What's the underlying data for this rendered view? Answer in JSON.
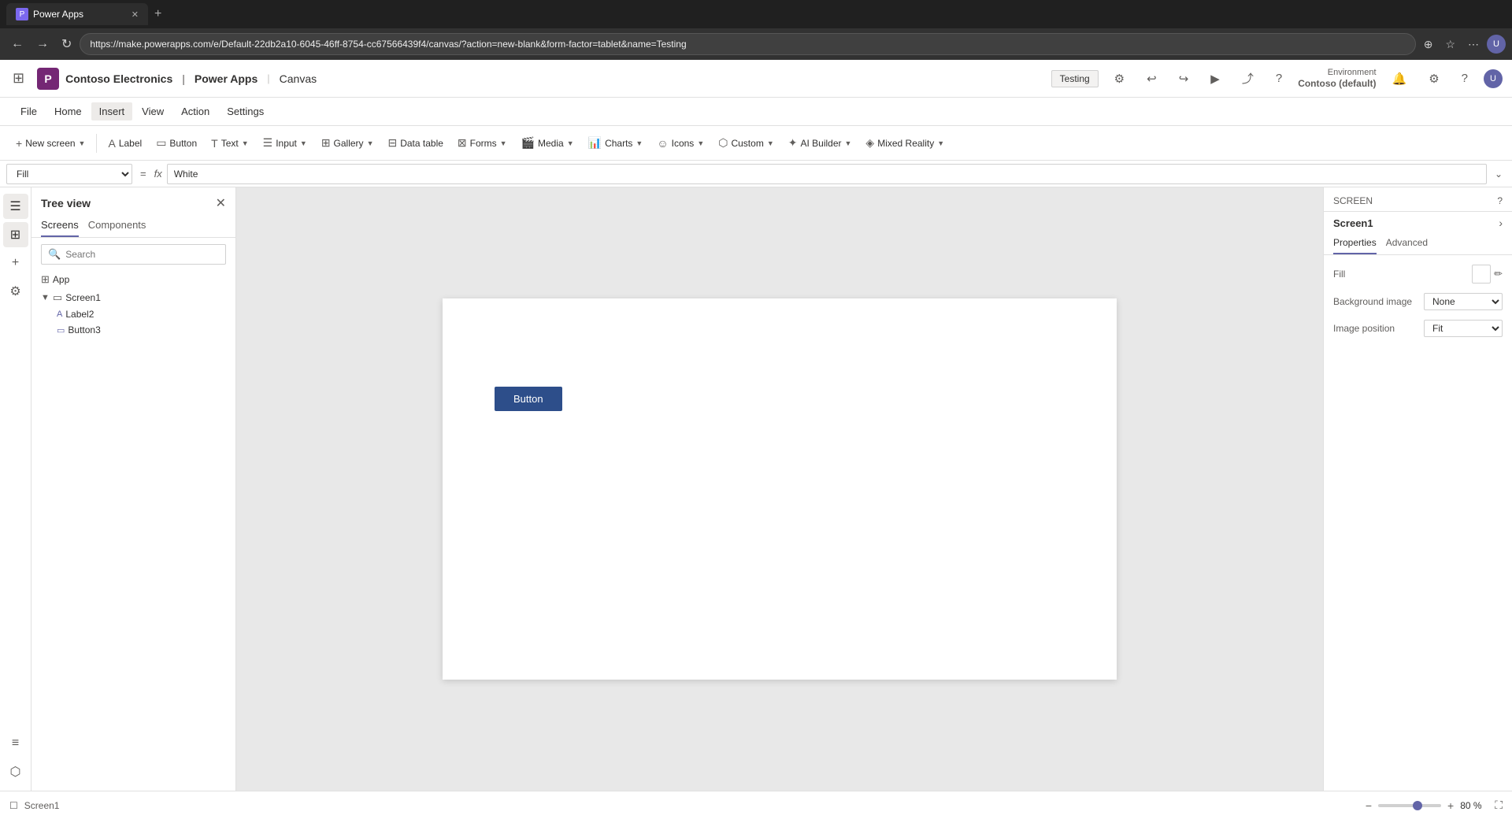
{
  "browser": {
    "tab_label": "Power Apps",
    "tab_icon": "P",
    "address": "https://make.powerapps.com/e/Default-22db2a10-6045-46ff-8754-cc67566439f4/canvas/?action=new-blank&form-factor=tablet&name=Testing",
    "add_tab_title": "New tab"
  },
  "header": {
    "waffle_icon": "⊞",
    "brand_name": "Contoso Electronics",
    "app_suite": "Power Apps",
    "divider": "|",
    "canvas": "Canvas",
    "env_label": "Environment",
    "env_name": "Contoso (default)",
    "testing_label": "Testing"
  },
  "menubar": {
    "items": [
      "File",
      "Home",
      "Insert",
      "View",
      "Action",
      "Settings"
    ],
    "active": "Insert"
  },
  "toolbar": {
    "new_screen_label": "New screen",
    "label_label": "Label",
    "button_label": "Button",
    "text_label": "Text",
    "input_label": "Input",
    "gallery_label": "Gallery",
    "data_table_label": "Data table",
    "forms_label": "Forms",
    "media_label": "Media",
    "charts_label": "Charts",
    "icons_label": "Icons",
    "custom_label": "Custom",
    "ai_builder_label": "AI Builder",
    "mixed_reality_label": "Mixed Reality"
  },
  "formula_bar": {
    "selector_value": "Fill",
    "equals_sign": "=",
    "fx_label": "fx",
    "formula_value": "White"
  },
  "treeview": {
    "title": "Tree view",
    "tabs": [
      "Screens",
      "Components"
    ],
    "active_tab": "Screens",
    "search_placeholder": "Search",
    "items": [
      {
        "type": "app",
        "label": "App",
        "icon": "⊞",
        "indent": 0
      },
      {
        "type": "screen",
        "label": "Screen1",
        "icon": "▭",
        "indent": 0,
        "expanded": true
      },
      {
        "type": "label",
        "label": "Label2",
        "icon": "A",
        "indent": 1
      },
      {
        "type": "button",
        "label": "Button3",
        "icon": "◻",
        "indent": 1
      }
    ]
  },
  "canvas": {
    "button_label": "Button"
  },
  "right_panel": {
    "section_label": "SCREEN",
    "help_icon": "?",
    "screen_name": "Screen1",
    "expand_icon": "›",
    "tabs": [
      "Properties",
      "Advanced"
    ],
    "active_tab": "Properties",
    "fill_label": "Fill",
    "background_image_label": "Background image",
    "background_image_value": "None",
    "image_position_label": "Image position",
    "image_position_value": "Fit"
  },
  "status_bar": {
    "screen_label": "Screen1",
    "zoom_minus": "−",
    "zoom_plus": "+",
    "zoom_percent": "80 %",
    "fullscreen_icon": "⛶"
  },
  "left_sidebar": {
    "icons": [
      {
        "name": "hamburger-icon",
        "symbol": "☰"
      },
      {
        "name": "layers-icon",
        "symbol": "⊞"
      },
      {
        "name": "add-icon",
        "symbol": "+"
      },
      {
        "name": "data-icon",
        "symbol": "⚙"
      },
      {
        "name": "variables-icon",
        "symbol": "≡"
      },
      {
        "name": "connections-icon",
        "symbol": "⬡"
      }
    ]
  }
}
